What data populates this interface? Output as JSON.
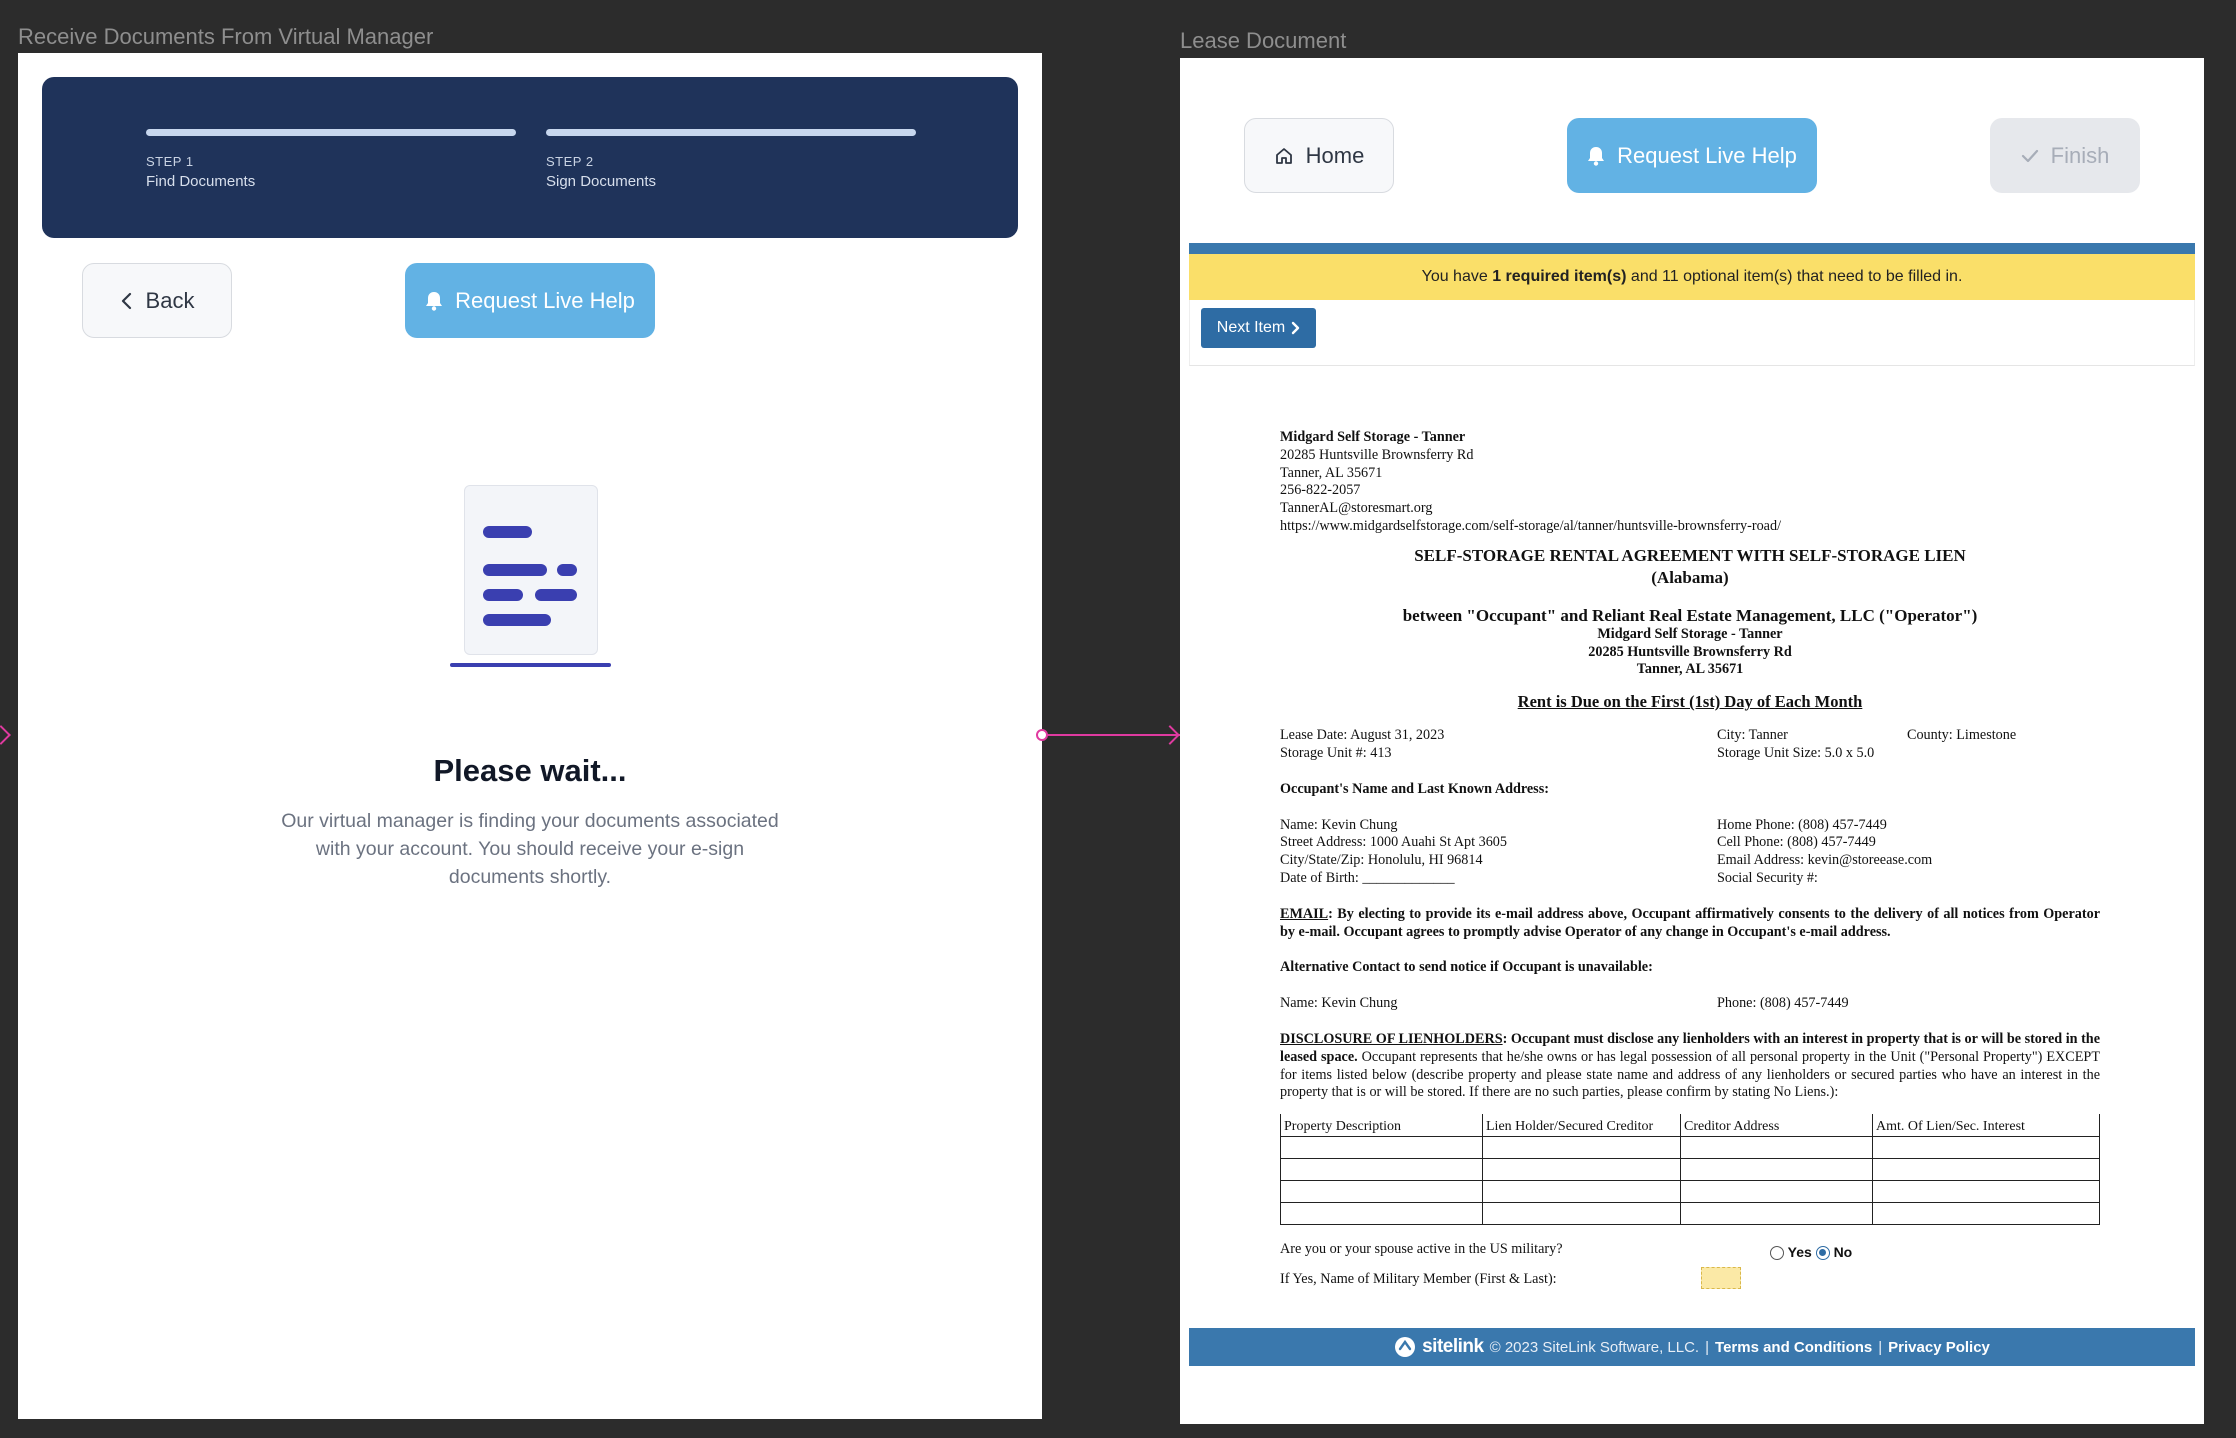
{
  "frames": {
    "left_title": "Receive Documents From Virtual Manager",
    "right_title": "Lease Document"
  },
  "stepper": {
    "steps": [
      {
        "num": "STEP 1",
        "name": "Find Documents"
      },
      {
        "num": "STEP 2",
        "name": "Sign Documents"
      }
    ]
  },
  "left": {
    "back_label": "Back",
    "help_label": "Request Live Help",
    "wait_title": "Please wait...",
    "wait_text": "Our virtual manager is finding your documents associated with your account. You should receive your e-sign documents shortly."
  },
  "right": {
    "home_label": "Home",
    "help_label": "Request Live Help",
    "finish_label": "Finish",
    "notice_pre": "You have ",
    "notice_bold": "1 required item(s)",
    "notice_post": " and 11 optional item(s) that need to be filled in.",
    "next_label": "Next Item"
  },
  "lease": {
    "facility_name": "Midgard Self Storage - Tanner",
    "facility_address": "20285 Huntsville Brownsferry Rd",
    "facility_city": "Tanner, AL 35671",
    "facility_phone": "256-822-2057",
    "facility_email": "TannerAL@storesmart.org",
    "facility_url": "https://www.midgardselfstorage.com/self-storage/al/tanner/huntsville-brownsferry-road/",
    "title": "SELF-STORAGE RENTAL AGREEMENT WITH SELF-STORAGE LIEN",
    "title_state": "(Alabama)",
    "between": "between \"Occupant\" and Reliant Real Estate Management, LLC (\"Operator\")",
    "between_name": "Midgard Self Storage - Tanner",
    "between_address": "20285 Huntsville Brownsferry Rd",
    "between_city": "Tanner, AL 35671",
    "rent_due": "Rent is Due on the First (1st) Day of Each Month",
    "lease_date": "Lease Date: August 31, 2023",
    "city": "City: Tanner",
    "county": "County: Limestone",
    "unit": "Storage Unit #: 413",
    "unit_size": "Storage Unit Size: 5.0 x 5.0",
    "occupant_heading": "Occupant's Name and Last Known Address:",
    "name": "Name: Kevin Chung",
    "home_phone": "Home Phone: (808) 457-7449",
    "street": "Street Address: 1000 Auahi St Apt 3605",
    "cell_phone": "Cell Phone: (808) 457-7449",
    "city_state_zip": "City/State/Zip: Honolulu, HI 96814",
    "email_address": "Email Address: kevin@storeease.com",
    "dob": "Date of Birth: _____________",
    "ssn": "Social Security #:",
    "email_label": "EMAIL",
    "email_text": ": By electing to provide its e-mail address above, Occupant affirmatively consents to the delivery of all notices from Operator by e-mail.  Occupant agrees to promptly advise Operator of any change in Occupant's e-mail address.",
    "alt_heading": "Alternative Contact to send notice if Occupant is unavailable:",
    "alt_name": "Name: Kevin Chung",
    "alt_phone": "Phone: (808) 457-7449",
    "disclosure_label": "DISCLOSURE OF LIENHOLDERS",
    "disclosure_bold": ": Occupant must disclose any lienholders with an interest in property that is or will be stored in the leased space.",
    "disclosure_text": " Occupant represents that he/she owns or has legal possession of all personal property in the Unit (\"Personal Property\") EXCEPT for items listed below (describe property and please state name and address of any lienholders or secured parties who have an interest in the property that is or will be stored. If there are no such parties, please confirm by stating No Liens.):",
    "table_headers": [
      "Property Description",
      "Lien Holder/Secured Creditor",
      "Creditor Address",
      "Amt. Of Lien/Sec. Interest"
    ],
    "military_q": "Are you or your spouse active in the US military?",
    "yes": "Yes",
    "no": "No",
    "military_name": "If Yes, Name of Military Member (First & Last):"
  },
  "footer": {
    "logo": "sitelink",
    "copyright": "© 2023 SiteLink Software, LLC.",
    "sep": "|",
    "terms": "Terms and Conditions",
    "privacy": "Privacy Policy"
  },
  "colors": {
    "stepper_bg": "#1f335a",
    "help_blue": "#62b2e4",
    "notice_yellow": "#fadf69",
    "brand_blue": "#3a78ad",
    "connector": "#e03aa0"
  },
  "icons": [
    "chevron-left-icon",
    "bell-icon",
    "home-icon",
    "check-icon",
    "chevron-right-icon",
    "document-icon"
  ]
}
